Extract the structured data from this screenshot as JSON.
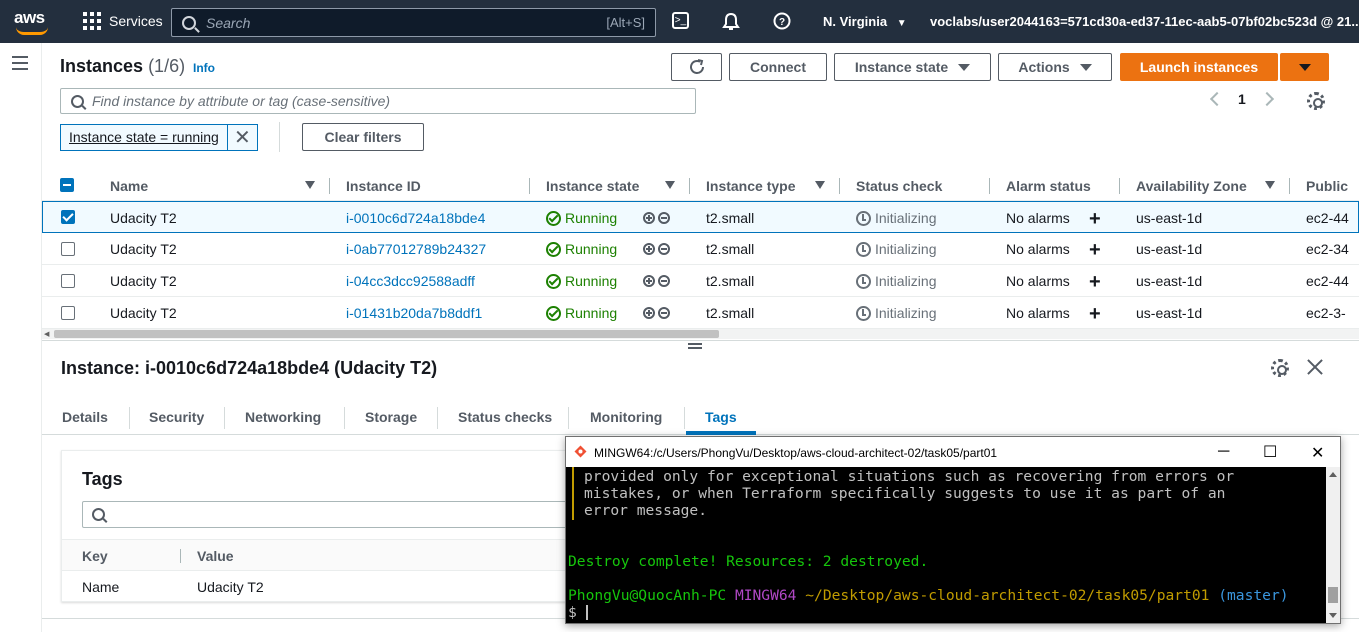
{
  "topnav": {
    "logo": "aws",
    "services": "Services",
    "search_placeholder": "Search",
    "search_shortcut": "[Alt+S]",
    "region": "N. Virginia",
    "account": "voclabs/user2044163=571cd30a-ed37-11ec-aab5-07bf02bc523d @ 21..."
  },
  "header": {
    "title": "Instances",
    "count": "(1/6)",
    "info": "Info",
    "connect": "Connect",
    "instance_state": "Instance state",
    "actions": "Actions",
    "launch": "Launch instances"
  },
  "filter": {
    "placeholder": "Find instance by attribute or tag (case-sensitive)",
    "token": "Instance state = running",
    "clear": "Clear filters",
    "page": "1"
  },
  "table": {
    "columns": [
      "Name",
      "Instance ID",
      "Instance state",
      "Instance type",
      "Status check",
      "Alarm status",
      "Availability Zone",
      "Public"
    ],
    "rows": [
      {
        "name": "Udacity T2",
        "id": "i-0010c6d724a18bde4",
        "state": "Running",
        "type": "t2.small",
        "status": "Initializing",
        "alarm": "No alarms",
        "az": "us-east-1d",
        "public": "ec2-44",
        "selected": true
      },
      {
        "name": "Udacity T2",
        "id": "i-0ab77012789b24327",
        "state": "Running",
        "type": "t2.small",
        "status": "Initializing",
        "alarm": "No alarms",
        "az": "us-east-1d",
        "public": "ec2-34",
        "selected": false
      },
      {
        "name": "Udacity T2",
        "id": "i-04cc3dcc92588adff",
        "state": "Running",
        "type": "t2.small",
        "status": "Initializing",
        "alarm": "No alarms",
        "az": "us-east-1d",
        "public": "ec2-44",
        "selected": false
      },
      {
        "name": "Udacity T2",
        "id": "i-01431b20da7b8ddf1",
        "state": "Running",
        "type": "t2.small",
        "status": "Initializing",
        "alarm": "No alarms",
        "az": "us-east-1d",
        "public": "ec2-3-",
        "selected": false
      }
    ]
  },
  "details": {
    "title": "Instance: i-0010c6d724a18bde4 (Udacity T2)",
    "tabs": [
      "Details",
      "Security",
      "Networking",
      "Storage",
      "Status checks",
      "Monitoring",
      "Tags"
    ],
    "active_tab": "Tags",
    "tags_title": "Tags",
    "key_header": "Key",
    "value_header": "Value",
    "tag_key": "Name",
    "tag_value": "Udacity T2"
  },
  "terminal": {
    "title": "MINGW64:/c/Users/PhongVu/Desktop/aws-cloud-architect-02/task05/part01",
    "line1": "provided only for exceptional situations such as recovering from errors or",
    "line2": "mistakes, or when Terraform specifically suggests to use it as part of an",
    "line3": "error message.",
    "destroy": "Destroy complete! Resources: 2 destroyed.",
    "prompt_user": "PhongVu@QuocAnh-PC",
    "prompt_shell": "MINGW64",
    "prompt_path": "~/Desktop/aws-cloud-architect-02/task05/part01",
    "prompt_branch": "(master)",
    "prompt_symbol": "$"
  },
  "colors": {
    "nav_bg": "#232f3e",
    "accent_orange": "#ec7211",
    "link_blue": "#0073bb",
    "running_green": "#1d8102"
  }
}
